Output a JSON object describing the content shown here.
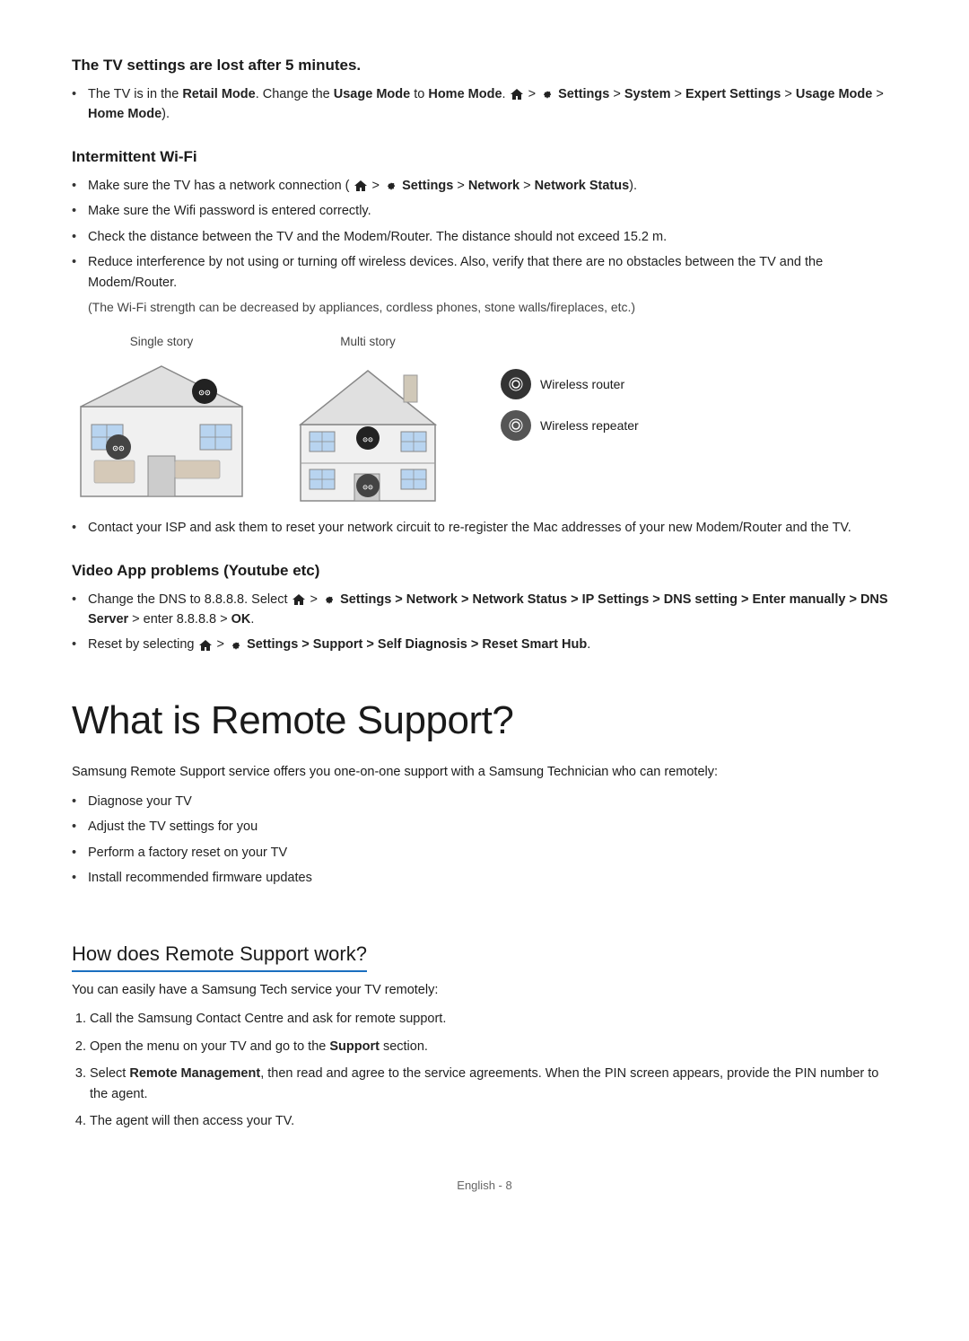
{
  "sections": {
    "tv_settings_lost": {
      "heading": "The TV settings are lost after 5 minutes.",
      "bullets": [
        {
          "text": "The TV is in the ",
          "bold1": "Retail Mode",
          "mid1": ". Change the ",
          "bold2": "Usage Mode",
          "mid2": " to ",
          "bold3": "Home Mode",
          "mid3": ". (",
          "path": "Settings > System > Expert Settings > Usage Mode > Home Mode",
          "end": ")."
        }
      ]
    },
    "intermittent_wifi": {
      "heading": "Intermittent Wi-Fi",
      "bullets": [
        "Make sure the TV has a network connection (Settings > Network > Network Status).",
        "Make sure the Wifi password is entered correctly.",
        "Check the distance between the TV and the Modem/Router. The distance should not exceed 15.2 m.",
        "Reduce interference by not using or turning off wireless devices. Also, verify that there are no obstacles between the TV and the Modem/Router."
      ],
      "note": "(The Wi-Fi strength can be decreased by appliances, cordless phones, stone walls/fireplaces, etc.)",
      "diagram_single_label": "Single story",
      "diagram_multi_label": "Multi story",
      "legend": {
        "router_label": "Wireless router",
        "repeater_label": "Wireless repeater"
      },
      "contact_bullet": "Contact your ISP and ask them to reset your network circuit to re-register the Mac addresses of your new Modem/Router and the TV."
    },
    "video_app_problems": {
      "heading": "Video App problems (Youtube etc)",
      "bullets": [
        {
          "pre": "Change the DNS to 8.8.8.8. Select ",
          "path": "Settings > Network > Network Status > IP Settings > DNS setting > Enter manually > DNS Server",
          "post": " > enter 8.8.8.8 > ",
          "bold_end": "OK",
          "end": "."
        },
        {
          "pre": "Reset by selecting ",
          "path": "Settings > Support > Self Diagnosis > Reset Smart Hub",
          "post": "."
        }
      ]
    }
  },
  "what_is_remote": {
    "big_heading": "What is Remote Support?",
    "intro": "Samsung Remote Support service offers you one-on-one support with a Samsung Technician who can remotely:",
    "bullets": [
      "Diagnose your TV",
      "Adjust the TV settings for you",
      "Perform a factory reset on your TV",
      "Install recommended firmware updates"
    ]
  },
  "how_does_remote": {
    "heading": "How does Remote Support work?",
    "intro": "You can easily have a Samsung Tech service your TV remotely:",
    "steps": [
      "Call the Samsung Contact Centre and ask for remote support.",
      "Open the menu on your TV and go to the <b>Support</b> section.",
      "Select <b>Remote Management</b>, then read and agree to the service agreements. When the PIN screen appears, provide the PIN number to the agent.",
      "The agent will then access your TV."
    ]
  },
  "footer": {
    "text": "English - 8"
  }
}
